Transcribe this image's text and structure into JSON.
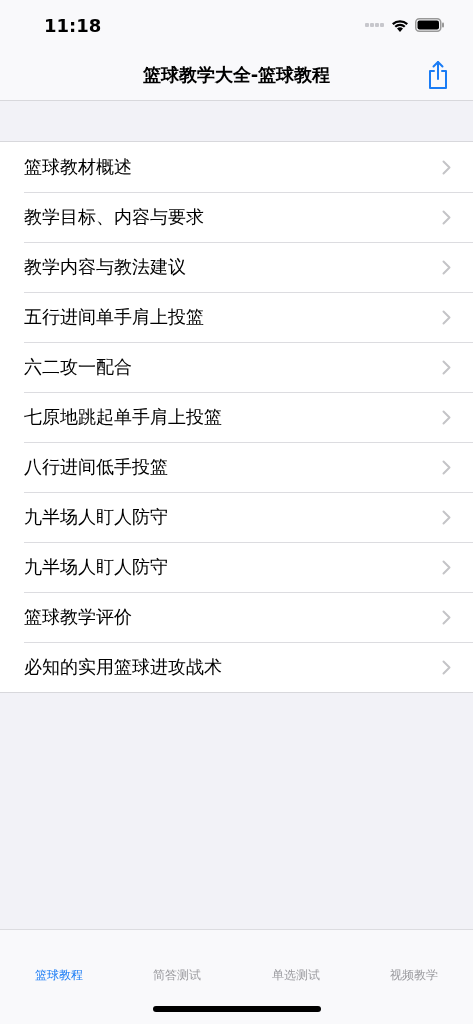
{
  "status_bar": {
    "time": "11:18"
  },
  "nav": {
    "title": "篮球教学大全-篮球教程"
  },
  "items": [
    {
      "label": "篮球教材概述"
    },
    {
      "label": "教学目标、内容与要求"
    },
    {
      "label": "教学内容与教法建议"
    },
    {
      "label": "五行进间单手肩上投篮"
    },
    {
      "label": "六二攻一配合"
    },
    {
      "label": "七原地跳起单手肩上投篮"
    },
    {
      "label": "八行进间低手投篮"
    },
    {
      "label": "九半场人盯人防守"
    },
    {
      "label": "九半场人盯人防守"
    },
    {
      "label": "篮球教学评价"
    },
    {
      "label": "必知的实用篮球进攻战术"
    }
  ],
  "tabs": [
    {
      "label": "篮球教程",
      "selected": true
    },
    {
      "label": "简答测试",
      "selected": false
    },
    {
      "label": "单选测试",
      "selected": false
    },
    {
      "label": "视频教学",
      "selected": false
    }
  ]
}
